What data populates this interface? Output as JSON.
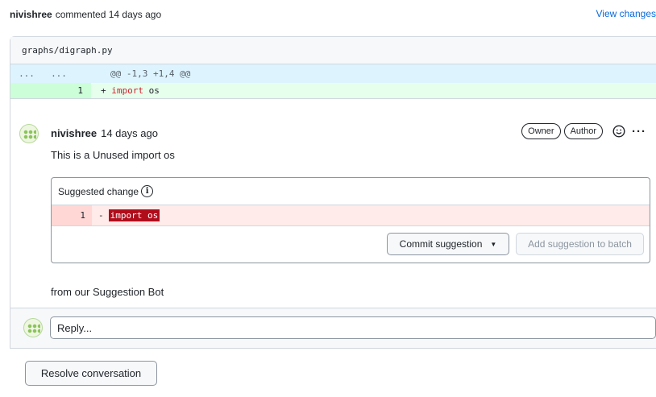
{
  "header": {
    "author": "nivishree",
    "meta": "commented 14 days ago",
    "view_changes": "View changes"
  },
  "diff": {
    "file_path": "graphs/digraph.py",
    "hunk_left": "...",
    "hunk_right": "...",
    "hunk_header": "@@ -1,3 +1,4 @@",
    "added_line_number": "1",
    "added_prefix": "+ ",
    "added_keyword": "import",
    "added_rest": " os"
  },
  "comment": {
    "author": "nivishree",
    "time": "14 days ago",
    "badges": [
      "Owner",
      "Author"
    ],
    "more": "···",
    "body": "This is a Unused import os",
    "footer": "from our Suggestion Bot"
  },
  "suggestion": {
    "title": "Suggested change",
    "info_glyph": "i",
    "line_number": "1",
    "prefix": "-",
    "code": "import os",
    "commit_label": "Commit suggestion",
    "commit_caret": "▼",
    "batch_label": "Add suggestion to batch"
  },
  "reply": {
    "placeholder": "Reply..."
  },
  "resolve": {
    "label": "Resolve conversation"
  }
}
